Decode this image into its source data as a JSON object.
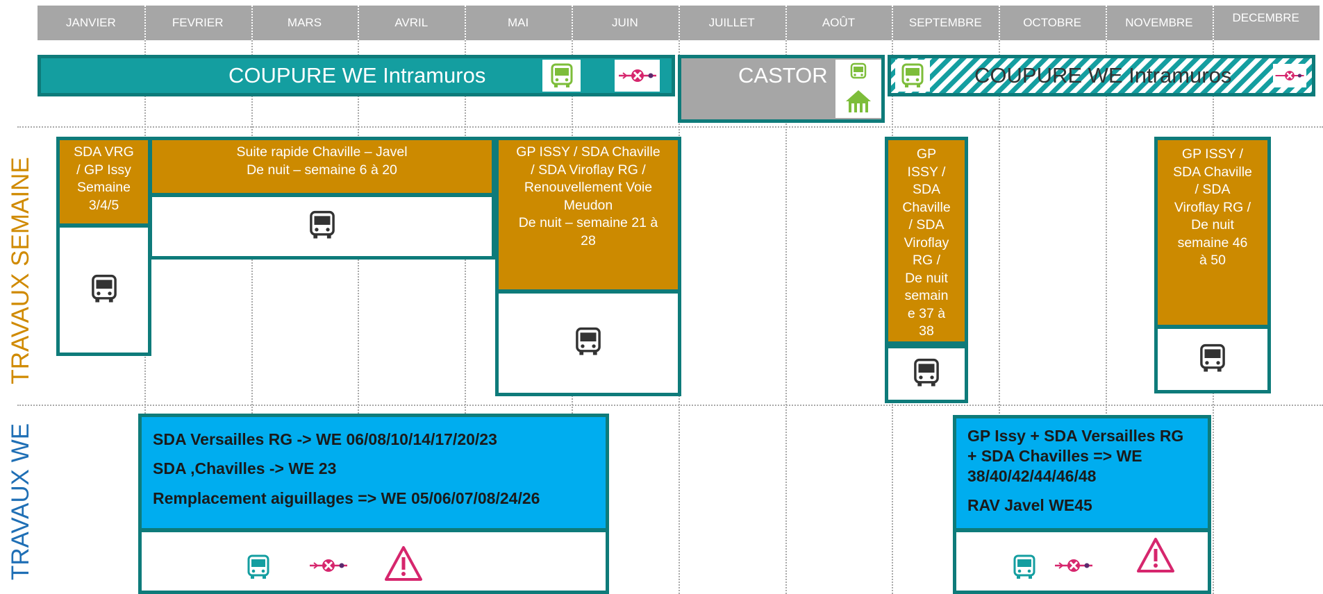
{
  "months": [
    "JANVIER",
    "FEVRIER",
    "MARS",
    "AVRIL",
    "MAI",
    "JUIN",
    "JUILLET",
    "AOÛT",
    "SEPTEMBRE",
    "OCTOBRE",
    "NOVEMBRE",
    "DECEMBRE"
  ],
  "rows": {
    "semaine_label": "TRAVAUX SEMAINE",
    "we_label": "TRAVAUX WE"
  },
  "top_bar": {
    "coupure_left": "COUPURE WE Intramuros",
    "castor": "CASTOR",
    "coupure_right": "COUPURE WE Intramuros"
  },
  "semaine": {
    "box1": [
      "SDA VRG",
      "/ GP Issy",
      "Semaine",
      "3/4/5"
    ],
    "box2": [
      "Suite rapide Chaville – Javel",
      "De nuit – semaine 6 à 20"
    ],
    "box3": [
      "GP ISSY / SDA Chaville",
      "/ SDA Viroflay RG /",
      "Renouvellement Voie",
      "Meudon",
      "De nuit – semaine 21 à",
      "28"
    ],
    "box4": [
      "GP",
      "ISSY /",
      "SDA",
      "Chaville",
      "/ SDA",
      "Viroflay",
      "RG /",
      "De nuit",
      "semain",
      "e 37 à",
      "38"
    ],
    "box5": [
      "GP ISSY /",
      "SDA Chaville",
      "/ SDA",
      "Viroflay RG /",
      "De nuit",
      "semaine 46",
      "à 50"
    ]
  },
  "we": {
    "left": [
      "SDA Versailles RG ->  WE 06/08/10/14/17/20/23",
      "SDA ,Chavilles -> WE 23",
      "Remplacement aiguillages => WE 05/06/07/08/24/26"
    ],
    "right": [
      "GP Issy + SDA Versailles RG",
      "+ SDA Chavilles => WE",
      "38/40/42/44/46/48",
      "RAV Javel WE45"
    ]
  },
  "icons": {
    "bus": "bus-icon",
    "bus_green": "bus-green-icon",
    "train_cut": "train-interruption-icon",
    "warning": "warning-triangle-icon",
    "depot": "depot-house-icon"
  },
  "colors": {
    "header": "#a6a6a6",
    "teal": "#149ea0",
    "teal_border": "#0e7b7a",
    "gold": "#cc8a00",
    "blue": "#00adef",
    "semaine_label": "#d08a00",
    "we_label": "#1f6fb5",
    "pink": "#d6266d",
    "green": "#7dbd3a"
  }
}
